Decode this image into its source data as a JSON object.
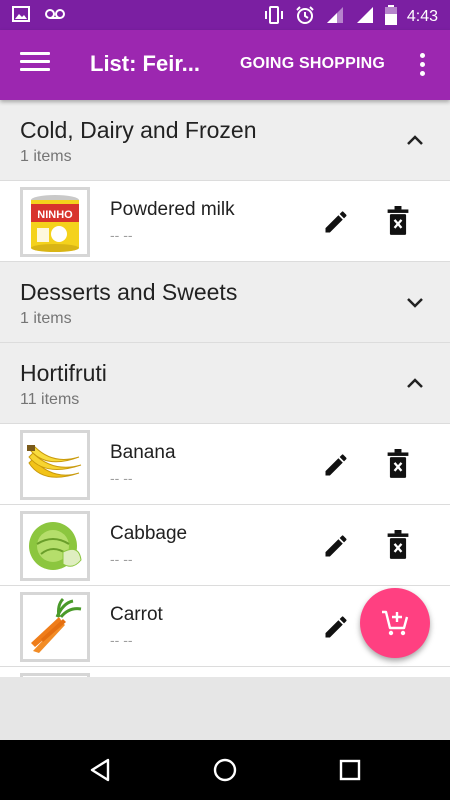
{
  "status_bar": {
    "time": "4:43",
    "icons": [
      "image-icon",
      "voicemail-icon",
      "vibrate-icon",
      "alarm-icon",
      "signal-icon",
      "signal-icon",
      "battery-icon"
    ]
  },
  "app_bar": {
    "title": "List: Feir...",
    "action_label": "GOING SHOPPING",
    "menu_icon": "hamburger-menu-icon",
    "overflow_icon": "more-vert-icon"
  },
  "categories": [
    {
      "name": "Cold, Dairy and Frozen",
      "count": "1 items",
      "expanded": true,
      "items": [
        {
          "name": "Powdered milk",
          "quantity": "-- --",
          "image": "ninho-powdered-milk-can"
        }
      ]
    },
    {
      "name": "Desserts and Sweets",
      "count": "1 items",
      "expanded": false,
      "items": []
    },
    {
      "name": "Hortifruti",
      "count": "11 items",
      "expanded": true,
      "items": [
        {
          "name": "Banana",
          "quantity": "-- --",
          "image": "banana-bunch"
        },
        {
          "name": "Cabbage",
          "quantity": "-- --",
          "image": "cabbage"
        },
        {
          "name": "Carrot",
          "quantity": "-- --",
          "image": "carrot-bunch"
        }
      ]
    }
  ],
  "product_labels": {
    "milk_brand": "NINHO"
  },
  "fab": {
    "icon": "add-shopping-cart-icon",
    "color": "#ff4081"
  },
  "colors": {
    "status_bar": "#7b1fa2",
    "app_bar": "#9c27b0",
    "category_bg": "#eeeeee",
    "accent": "#ff4081"
  },
  "nav_bar": {
    "icons": [
      "back-icon",
      "home-icon",
      "recents-icon"
    ]
  }
}
